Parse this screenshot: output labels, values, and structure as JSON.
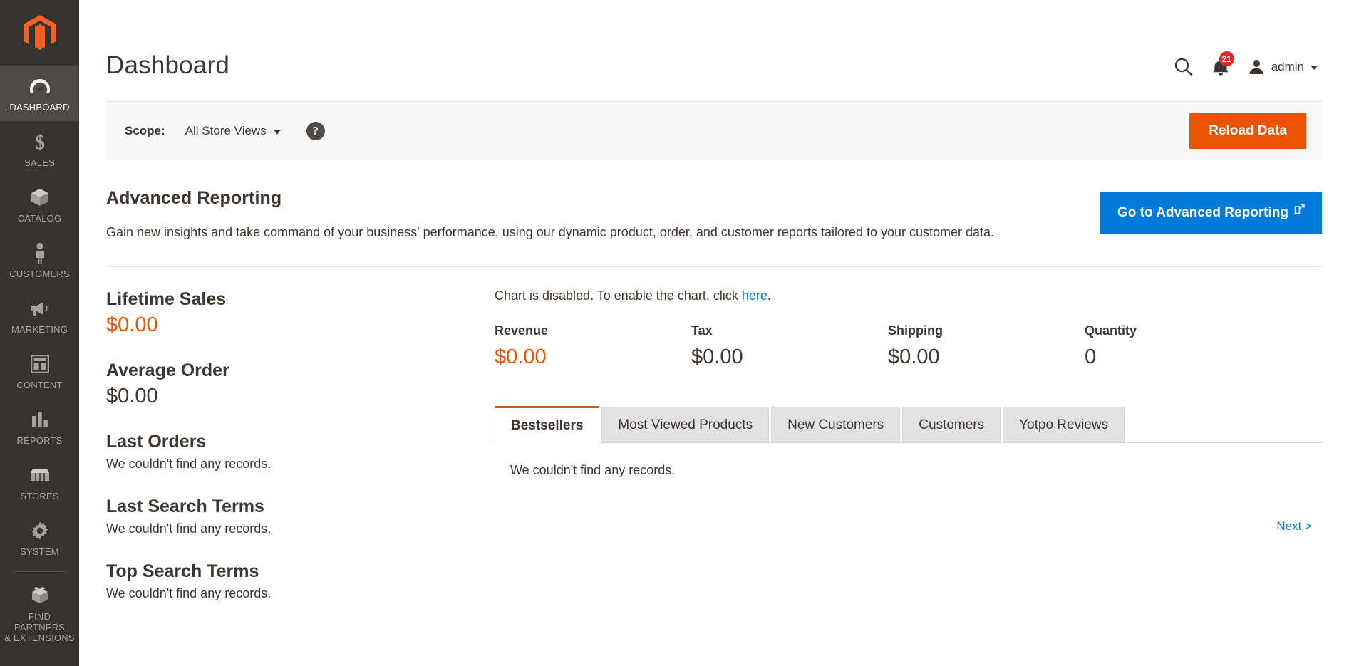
{
  "sidebar": {
    "logo": "magento-logo",
    "items": [
      {
        "label": "DASHBOARD",
        "icon": "dashboard-gauge-icon",
        "active": true
      },
      {
        "label": "SALES",
        "icon": "dollar-sign-icon",
        "active": false
      },
      {
        "label": "CATALOG",
        "icon": "box-icon",
        "active": false
      },
      {
        "label": "CUSTOMERS",
        "icon": "person-icon",
        "active": false
      },
      {
        "label": "MARKETING",
        "icon": "megaphone-icon",
        "active": false
      },
      {
        "label": "CONTENT",
        "icon": "layout-window-icon",
        "active": false
      },
      {
        "label": "REPORTS",
        "icon": "bar-chart-icon",
        "active": false
      },
      {
        "label": "STORES",
        "icon": "storefront-icon",
        "active": false
      },
      {
        "label": "SYSTEM",
        "icon": "gear-icon",
        "active": false
      }
    ],
    "partners": {
      "label_line1": "FIND PARTNERS",
      "label_line2": "& EXTENSIONS",
      "icon": "lego-brick-icon"
    }
  },
  "header": {
    "title": "Dashboard",
    "search_icon": "search-icon",
    "notifications_icon": "bell-icon",
    "notifications_count": "21",
    "account_icon": "user-avatar-icon",
    "account_name": "admin",
    "caret_icon": "chevron-down-icon"
  },
  "scope_bar": {
    "label": "Scope:",
    "value": "All Store Views",
    "help_icon": "question-mark-icon",
    "help_glyph": "?",
    "reload_label": "Reload Data",
    "reload_color": "#eb5202"
  },
  "advanced_reporting": {
    "title": "Advanced Reporting",
    "description": "Gain new insights and take command of your business' performance, using our dynamic product, order, and customer reports tailored to your customer data.",
    "button_label": "Go to Advanced Reporting",
    "button_icon": "external-link-icon",
    "button_color": "#007bdb"
  },
  "left_column": {
    "lifetime_sales": {
      "title": "Lifetime Sales",
      "value": "$0.00"
    },
    "average_order": {
      "title": "Average Order",
      "value": "$0.00"
    },
    "last_orders": {
      "title": "Last Orders",
      "empty": "We couldn't find any records."
    },
    "last_search_terms": {
      "title": "Last Search Terms",
      "empty": "We couldn't find any records."
    },
    "top_search_terms": {
      "title": "Top Search Terms",
      "empty": "We couldn't find any records."
    }
  },
  "right_column": {
    "chart_notice_prefix": "Chart is disabled. To enable the chart, click ",
    "chart_notice_link": "here",
    "chart_notice_suffix": ".",
    "totals": [
      {
        "label": "Revenue",
        "value": "$0.00",
        "accent": true
      },
      {
        "label": "Tax",
        "value": "$0.00",
        "accent": false
      },
      {
        "label": "Shipping",
        "value": "$0.00",
        "accent": false
      },
      {
        "label": "Quantity",
        "value": "0",
        "accent": false
      }
    ],
    "tabs": [
      {
        "label": "Bestsellers",
        "active": true
      },
      {
        "label": "Most Viewed Products",
        "active": false
      },
      {
        "label": "New Customers",
        "active": false
      },
      {
        "label": "Customers",
        "active": false
      },
      {
        "label": "Yotpo Reviews",
        "active": false
      }
    ],
    "panel_empty": "We couldn't find any records.",
    "next_label": "Next >"
  },
  "colors": {
    "accent_orange": "#eb5202",
    "link_blue": "#007bdb",
    "sidebar_bg": "#373330",
    "sidebar_active": "#4f4a45",
    "badge_red": "#e22626"
  }
}
